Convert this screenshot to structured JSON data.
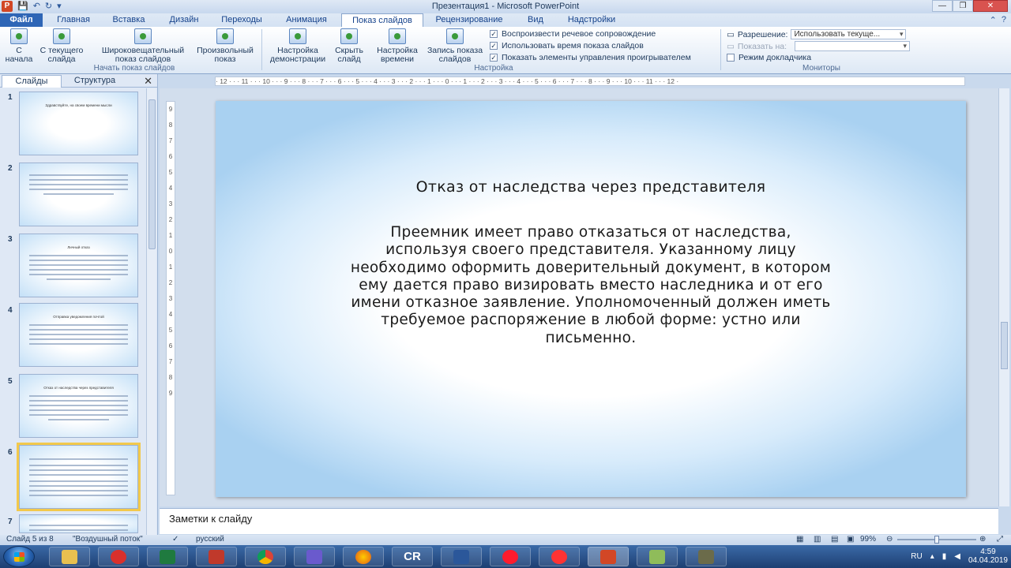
{
  "window": {
    "title": "Презентация1 - Microsoft PowerPoint",
    "minimize": "—",
    "restore": "❐",
    "close": "✕"
  },
  "qat": {
    "save": "💾",
    "undo": "↶",
    "redo": "↻",
    "more": "▾"
  },
  "tabs": [
    "Файл",
    "Главная",
    "Вставка",
    "Дизайн",
    "Переходы",
    "Анимация",
    "Показ слайдов",
    "Рецензирование",
    "Вид",
    "Надстройки"
  ],
  "active_tab": "Показ слайдов",
  "ribbon": {
    "start": {
      "from_start": "С начала",
      "from_current": "С текущего слайда",
      "broadcast": "Широковещательный показ слайдов",
      "custom": "Произвольный показ",
      "label": "Начать показ слайдов"
    },
    "setup": {
      "setup_show": "Настройка демонстрации",
      "hide_slide": "Скрыть слайд",
      "rehearse": "Настройка времени",
      "record": "Запись показа слайдов",
      "label": "Настройка"
    },
    "checks": [
      {
        "label": "Воспроизвести речевое сопровождение",
        "checked": true
      },
      {
        "label": "Использовать время показа слайдов",
        "checked": true
      },
      {
        "label": "Показать элементы управления проигрывателем",
        "checked": true
      }
    ],
    "monitors": {
      "resolution_label": "Разрешение:",
      "resolution_value": "Использовать текуще...",
      "show_on_label": "Показать на:",
      "show_on_value": "",
      "presenter_view": "Режим докладчика",
      "presenter_checked": false,
      "label": "Мониторы"
    }
  },
  "left_pane": {
    "tab_slides": "Слайды",
    "tab_outline": "Структура",
    "close": "✕",
    "slides": [
      {
        "num": "1",
        "text": "Здравствуйте, на своем времени мысли"
      },
      {
        "num": "2"
      },
      {
        "num": "3",
        "text": "Личный отказ"
      },
      {
        "num": "4",
        "text": "Отправка уведомления почтой"
      },
      {
        "num": "5",
        "text": "Отказ от наследства через представителя"
      },
      {
        "num": "6"
      },
      {
        "num": "7"
      }
    ],
    "selected": "6"
  },
  "ruler": {
    "h": "· 12 · · · 11 · · · 10 · · · 9 · · · 8 · · · 7 · · · 6 · · · 5 · · · 4 · · · 3 · · · 2 · · · 1 · · · 0 · · · 1 · · · 2 · · · 3 · · · 4 · · · 5 · · · 6 · · · 7 · · · 8 · · · 9 · · · 10 · · · 11 · · · 12 ·",
    "v": [
      "9",
      "8",
      "7",
      "6",
      "5",
      "4",
      "3",
      "2",
      "1",
      "0",
      "1",
      "2",
      "3",
      "4",
      "5",
      "6",
      "7",
      "8",
      "9"
    ]
  },
  "slide": {
    "title": "Отказ от наследства через представителя",
    "body": "Преемник имеет право отказаться от наследства, используя своего представителя. Указанному лицу необходимо оформить доверительный документ, в котором ему дается право визировать вместо наследника и от его имени отказное заявление. Уполномоченный должен иметь требуемое распоряжение в любой форме: устно или письменно."
  },
  "notes": {
    "placeholder": "Заметки к слайду"
  },
  "status": {
    "slide": "Слайд 5 из 8",
    "theme": "\"Воздушный поток\"",
    "language": "русский",
    "zoom": "99%",
    "zoom_level": 0.5
  },
  "taskbar": {
    "apps": [
      "explorer",
      "close-app",
      "excel",
      "pdf",
      "chrome",
      "powerpoint-save",
      "firefox",
      "CR",
      "word",
      "opera",
      "yandex",
      "powerpoint",
      "folder",
      "camera"
    ],
    "cr_label": "CR",
    "lang": "RU",
    "time": "4:59",
    "date": "04.04.2019"
  },
  "colors": {
    "accent": "#2f66b6",
    "file_tab": "#2f66b6",
    "selected_thumb": "#f2c94c"
  }
}
